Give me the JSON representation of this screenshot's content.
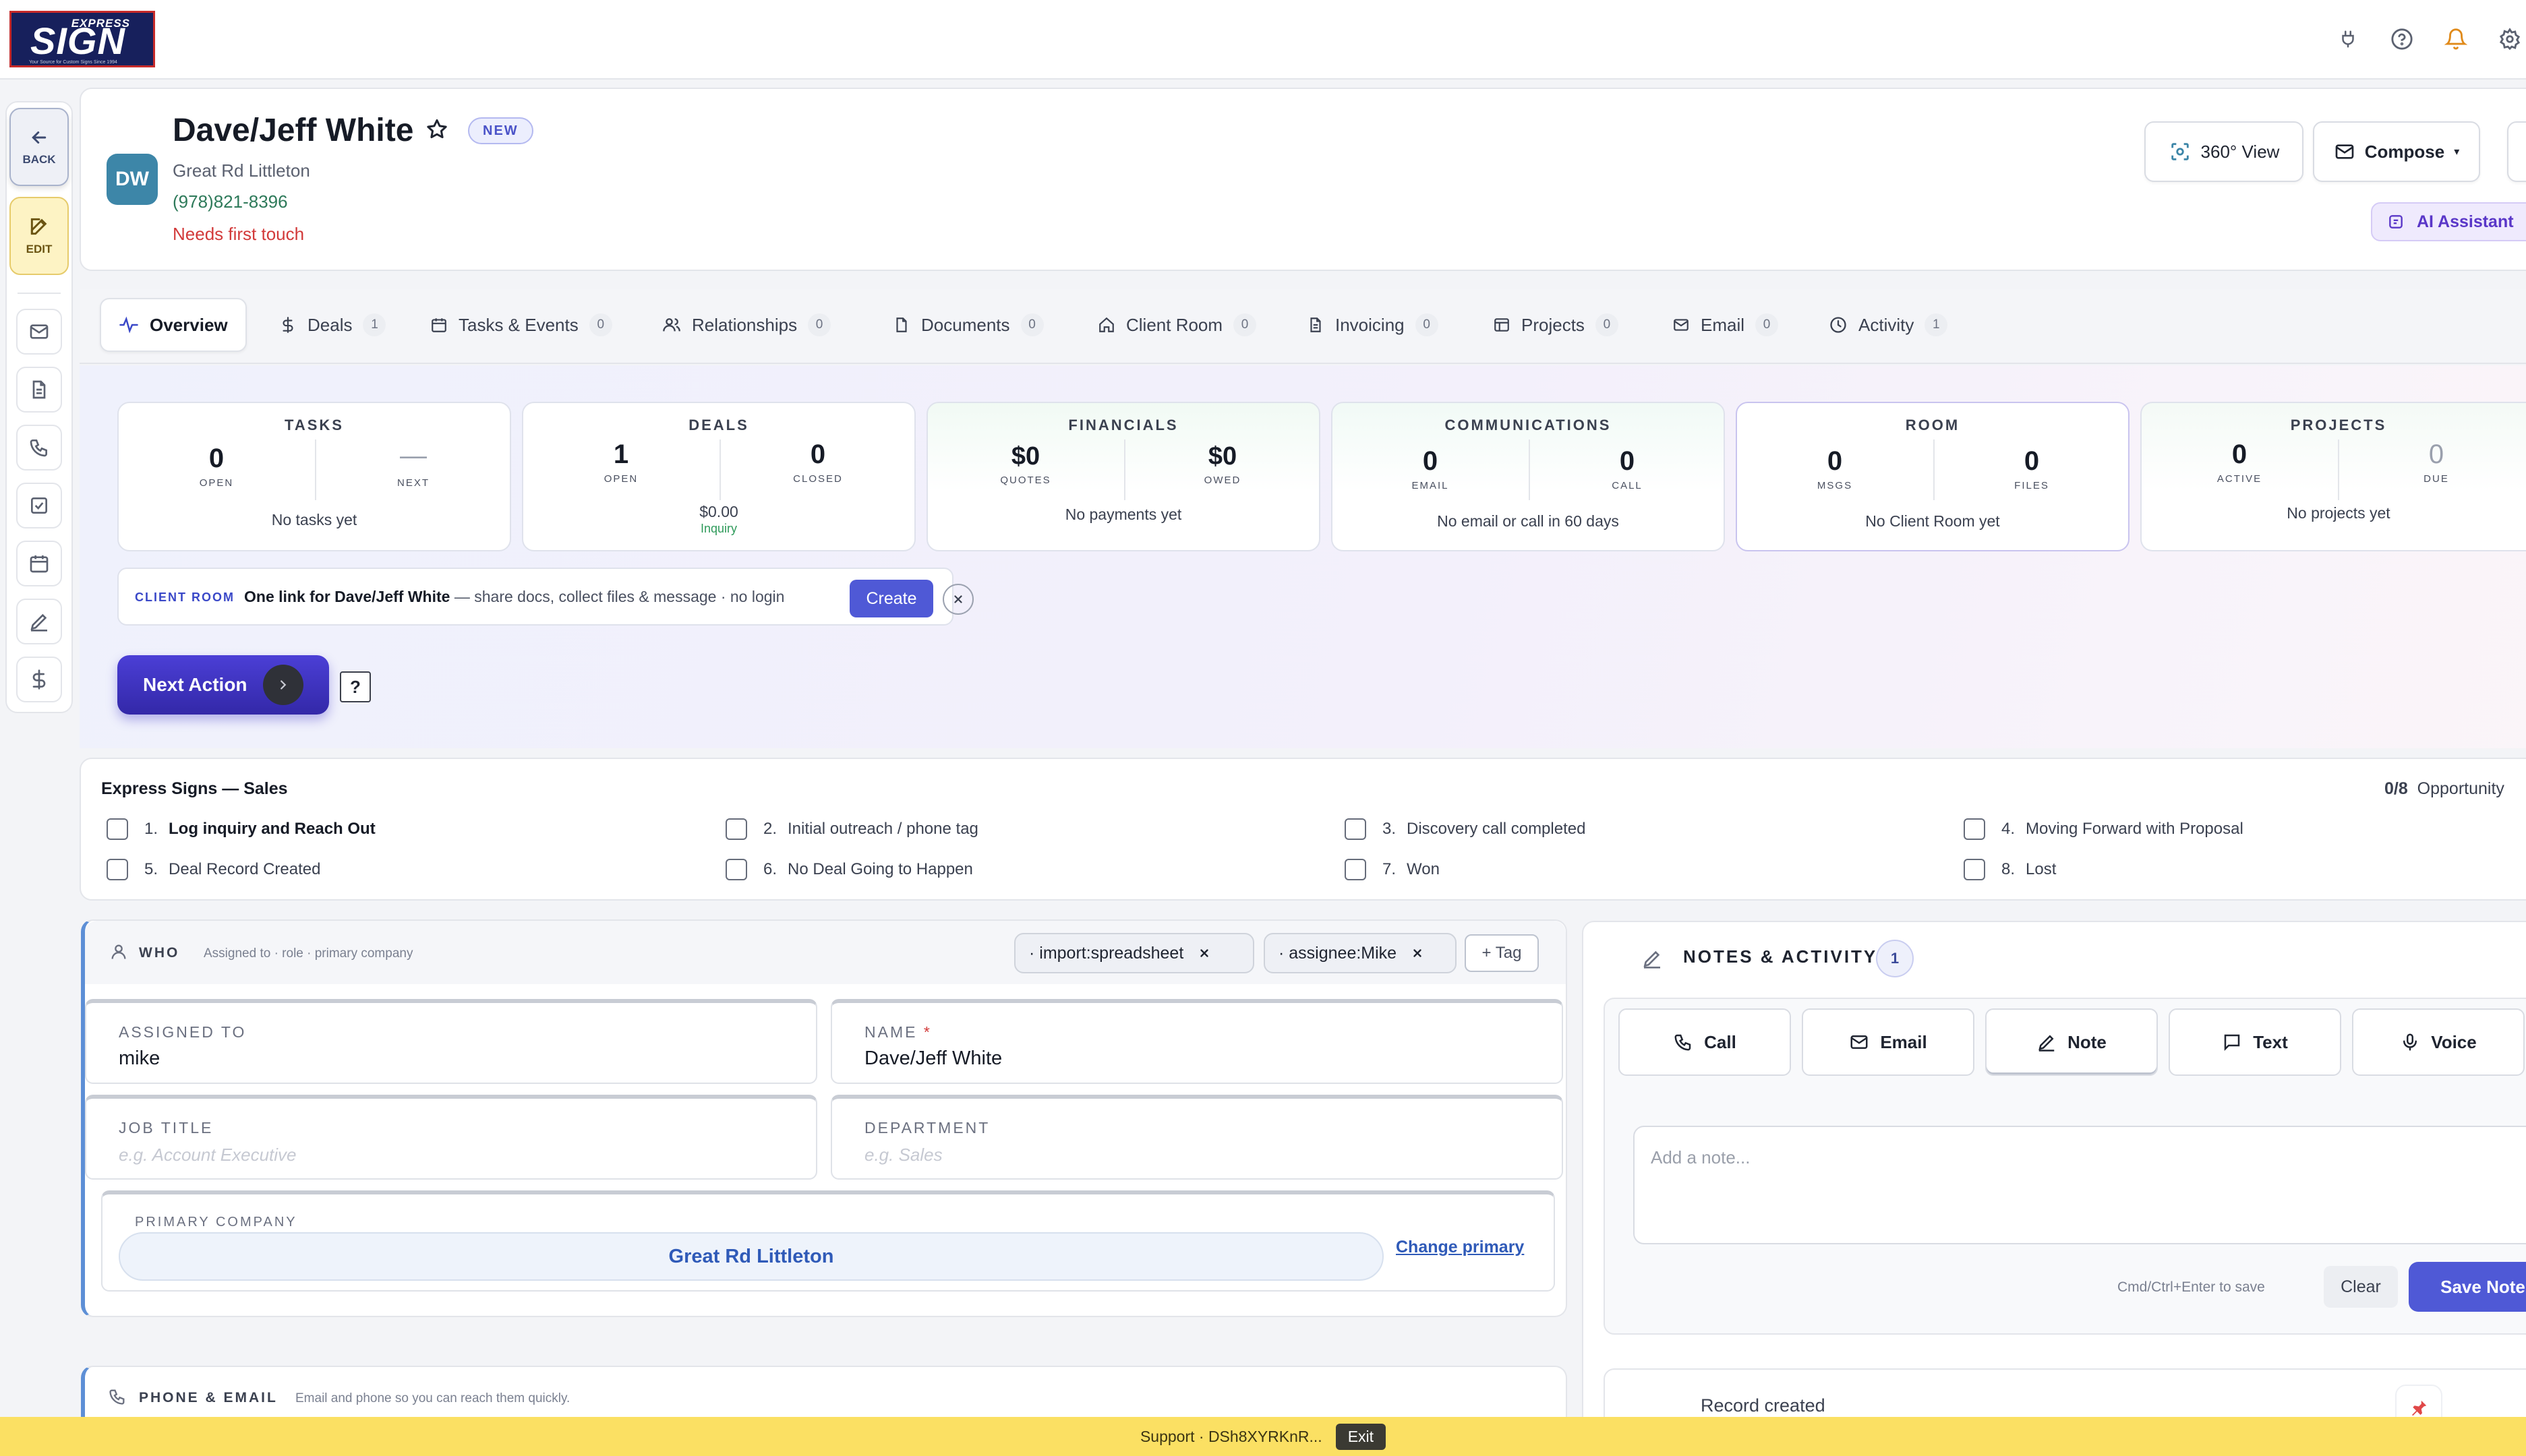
{
  "brand": {
    "line1": "EXPRESS",
    "line2": "SIGN",
    "tagline": "Your Source for Custom Signs Since 1994"
  },
  "rail": {
    "back_label": "BACK",
    "edit_label": "EDIT"
  },
  "person": {
    "initials": "DW",
    "name": "Dave/Jeff White",
    "badge": "NEW",
    "company": "Great Rd Littleton",
    "phone": "(978)821-8396",
    "status": "Needs first touch"
  },
  "header_actions": {
    "view360": "360° View",
    "compose": "Compose",
    "ai": "AI Assistant"
  },
  "tabs": [
    {
      "label": "Overview"
    },
    {
      "label": "Deals",
      "count": "1"
    },
    {
      "label": "Tasks & Events",
      "count": "0"
    },
    {
      "label": "Relationships",
      "count": "0"
    },
    {
      "label": "Documents",
      "count": "0"
    },
    {
      "label": "Client Room",
      "count": "0"
    },
    {
      "label": "Invoicing",
      "count": "0"
    },
    {
      "label": "Projects",
      "count": "0"
    },
    {
      "label": "Email",
      "count": "0"
    },
    {
      "label": "Activity",
      "count": "1"
    }
  ],
  "stats": {
    "tasks": {
      "title": "TASKS",
      "open": "0",
      "open_label": "OPEN",
      "next": "—",
      "next_label": "NEXT",
      "foot": "No tasks yet"
    },
    "deals": {
      "title": "DEALS",
      "open": "1",
      "open_label": "OPEN",
      "closed": "0",
      "closed_label": "CLOSED",
      "amount": "$0.00",
      "stage": "Inquiry"
    },
    "financials": {
      "title": "FINANCIALS",
      "quotes": "$0",
      "quotes_label": "QUOTES",
      "owed": "$0",
      "owed_label": "OWED",
      "foot": "No payments yet"
    },
    "communications": {
      "title": "COMMUNICATIONS",
      "email": "0",
      "email_label": "EMAIL",
      "call": "0",
      "call_label": "CALL",
      "foot": "No email or call in 60 days"
    },
    "room": {
      "title": "ROOM",
      "msgs": "0",
      "msgs_label": "MSGS",
      "files": "0",
      "files_label": "FILES",
      "foot": "No Client Room yet"
    },
    "projects": {
      "title": "PROJECTS",
      "active": "0",
      "active_label": "ACTIVE",
      "due": "0",
      "due_label": "DUE",
      "foot": "No projects yet"
    }
  },
  "client_room": {
    "label": "CLIENT ROOM",
    "bold": "One link for Dave/Jeff White",
    "rest": " — share docs, collect files & message · no login",
    "create": "Create"
  },
  "next_action": {
    "label": "Next Action",
    "help": "?"
  },
  "stages": {
    "title": "Express Signs — Sales",
    "progress": "0/8",
    "progress_label": "Opportunity",
    "items": [
      {
        "num": "1.",
        "label": "Log inquiry and Reach Out"
      },
      {
        "num": "2.",
        "label": "Initial outreach / phone tag"
      },
      {
        "num": "3.",
        "label": "Discovery call completed"
      },
      {
        "num": "4.",
        "label": "Moving Forward with Proposal"
      },
      {
        "num": "5.",
        "label": "Deal Record Created"
      },
      {
        "num": "6.",
        "label": "No Deal Going to Happen"
      },
      {
        "num": "7.",
        "label": "Won"
      },
      {
        "num": "8.",
        "label": "Lost"
      }
    ]
  },
  "who": {
    "title": "WHO",
    "subtitle": "Assigned to · role · primary company",
    "tags": [
      "· import:spreadsheet",
      "· assignee:Mike"
    ],
    "add_tag": "+ Tag",
    "assigned_label": "ASSIGNED TO",
    "assigned_value": "mike",
    "name_label": "NAME",
    "name_req": "*",
    "name_value": "Dave/Jeff White",
    "job_label": "JOB TITLE",
    "job_placeholder": "e.g. Account Executive",
    "dept_label": "DEPARTMENT",
    "dept_placeholder": "e.g. Sales",
    "company_label": "PRIMARY COMPANY",
    "company_value": "Great Rd Littleton",
    "change_primary": "Change primary"
  },
  "phone_email": {
    "title": "PHONE & EMAIL",
    "subtitle": "Email and phone so you can reach them quickly."
  },
  "notes": {
    "title": "NOTES & ACTIVITY",
    "count": "1",
    "types": [
      "Call",
      "Email",
      "Note",
      "Text",
      "Voice"
    ],
    "placeholder": "Add a note...",
    "hint": "Cmd/Ctrl+Enter to save",
    "clear": "Clear",
    "save": "Save Note",
    "record": "Record created"
  },
  "support": {
    "text": "Support · DSh8XYRKnR...",
    "exit": "Exit"
  },
  "colors": {
    "accent": "#4f59d6",
    "warning": "#d23a3a",
    "support_bar": "#fbe063",
    "avatar": "#3d86a8"
  }
}
